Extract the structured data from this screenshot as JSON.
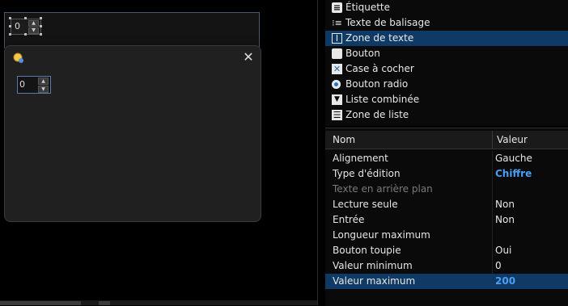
{
  "designer": {
    "form_spin_value": "0",
    "dialog_spin_value": "0"
  },
  "dialog": {
    "close_symbol": "✕"
  },
  "toolbox": {
    "items": [
      {
        "label": "Étiquette",
        "icon": "label-icon"
      },
      {
        "label": "Texte de balisage",
        "icon": "markup-text-icon"
      },
      {
        "label": "Zone de texte",
        "icon": "text-box-icon",
        "selected": true
      },
      {
        "label": "Bouton",
        "icon": "button-icon"
      },
      {
        "label": "Case à cocher",
        "icon": "checkbox-icon"
      },
      {
        "label": "Bouton radio",
        "icon": "radio-button-icon"
      },
      {
        "label": "Liste combinée",
        "icon": "combo-list-icon"
      },
      {
        "label": "Zone de liste",
        "icon": "list-box-icon"
      }
    ]
  },
  "properties": {
    "header": {
      "name": "Nom",
      "value": "Valeur"
    },
    "rows": [
      {
        "name": "Alignement",
        "value": "Gauche"
      },
      {
        "name": "Type d'édition",
        "value": "Chiffre",
        "accent": true
      },
      {
        "name": "Texte en arrière plan",
        "value": "",
        "disabled": true
      },
      {
        "name": "Lecture seule",
        "value": "Non"
      },
      {
        "name": "Entrée",
        "value": "Non"
      },
      {
        "name": "Longueur maximum",
        "value": ""
      },
      {
        "name": "Bouton toupie",
        "value": "Oui"
      },
      {
        "name": "Valeur minimum",
        "value": "0"
      },
      {
        "name": "Valeur maximum",
        "value": "200",
        "accent": true,
        "selected": true
      }
    ]
  },
  "colors": {
    "selection": "#0f3a66",
    "accent_text": "#4a9ff5"
  }
}
